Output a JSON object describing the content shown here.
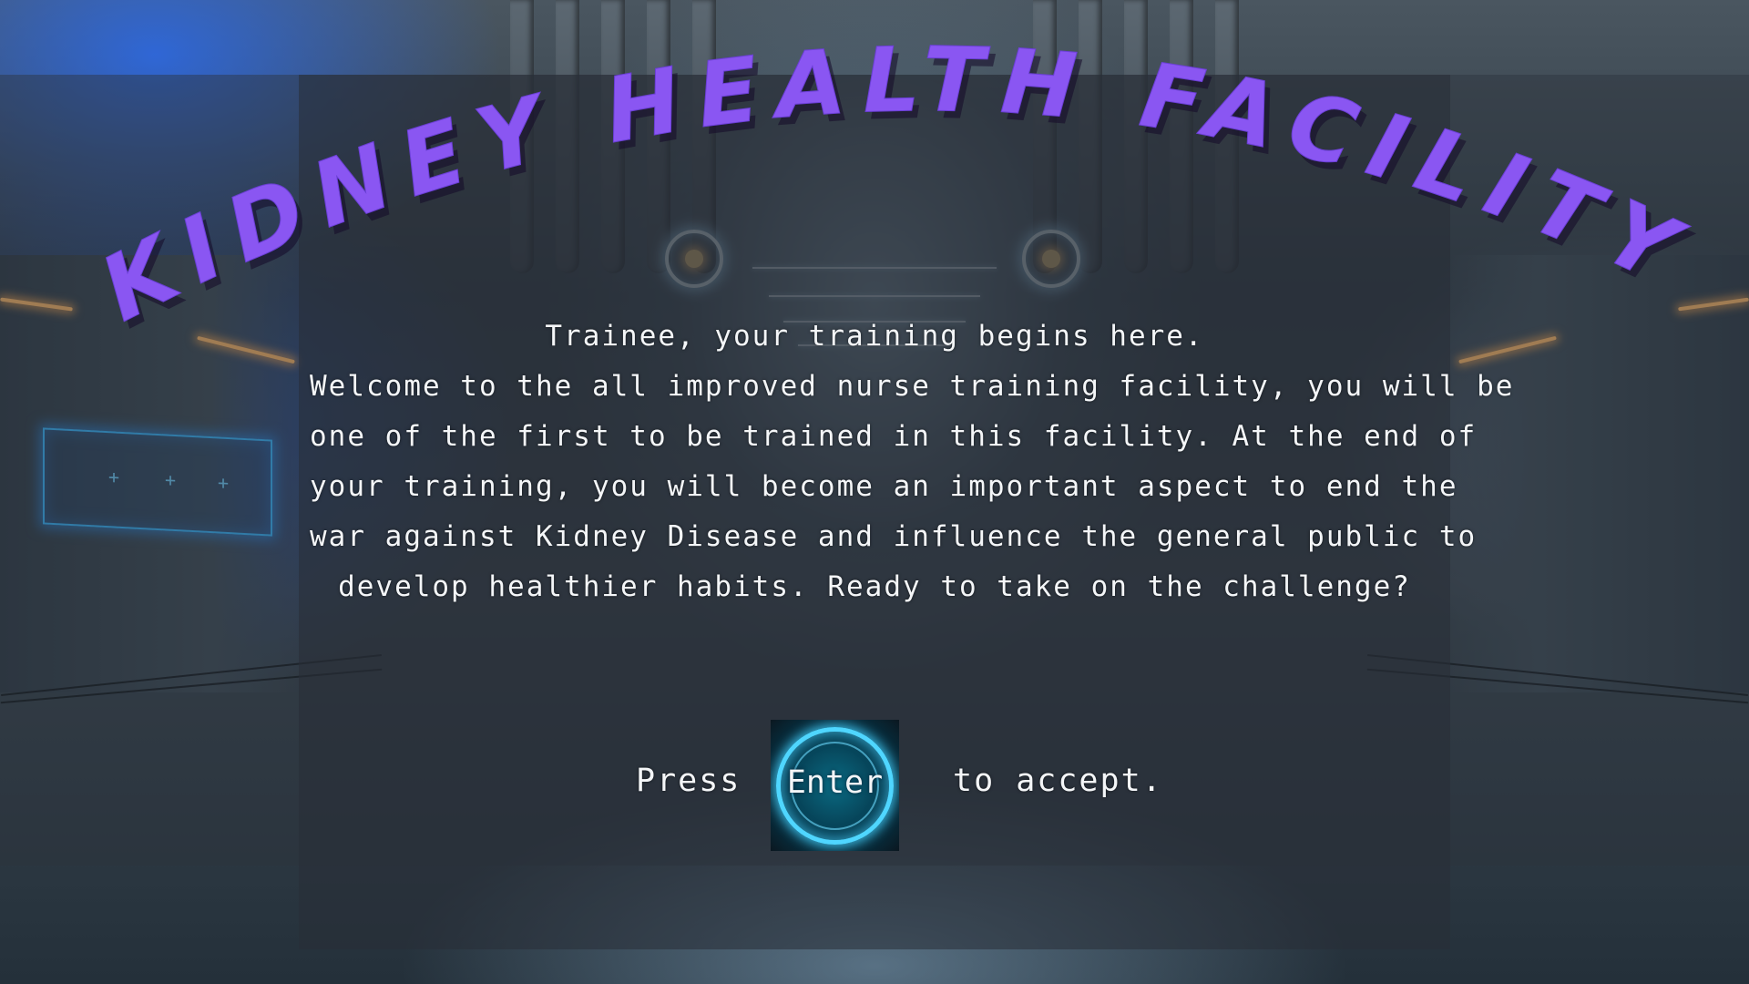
{
  "title": "KIDNEY HEALTH FACILITY",
  "intro": {
    "line1": "Trainee, your training  begins here.",
    "line2": "Welcome to the all improved nurse training facility, you will be",
    "line3": "one of the first to be trained in this facility. At the end of",
    "line4": "your training, you will become an important aspect to end the",
    "line5": "war against Kidney Disease and influence the general public to",
    "line6": "develop healthier habits. Ready to take on the challenge?"
  },
  "prompt": {
    "before": "Press",
    "key_label": "Enter",
    "after": "to accept."
  },
  "colors": {
    "title": "#8a56f2",
    "text": "#f4f6f8",
    "key_ring": "#4fd6ff",
    "accent_blue": "#35b6ff"
  },
  "icons": {
    "enter_key": "glowing-ring-key-icon"
  }
}
